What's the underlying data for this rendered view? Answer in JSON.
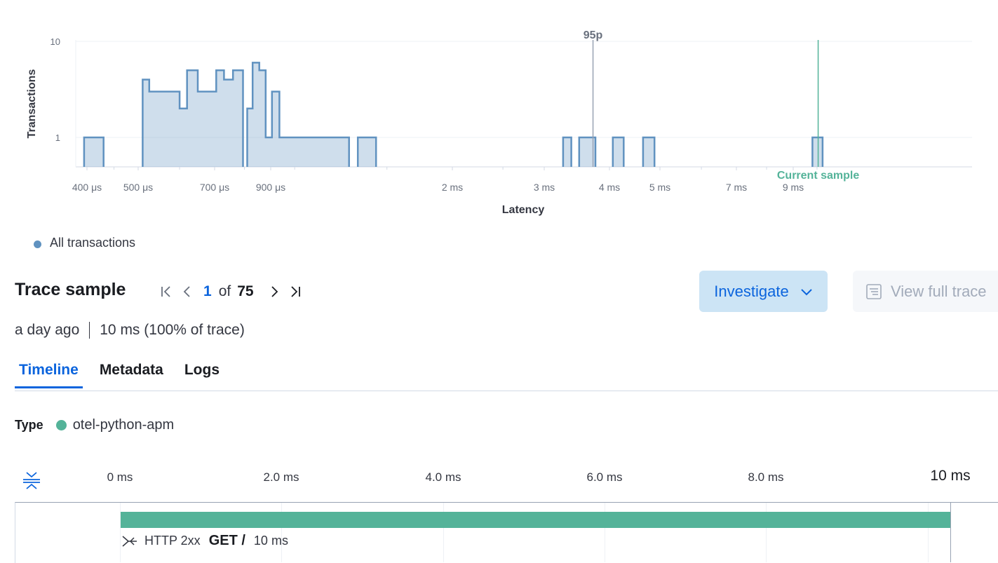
{
  "chart_data": {
    "type": "bar",
    "xlabel": "Latency",
    "ylabel": "Transactions",
    "y_scale": "log",
    "y_ticks": [
      "1",
      "10"
    ],
    "x_scale": "log",
    "x_ticks": [
      "400 μs",
      "500 μs",
      "700 μs",
      "900 μs",
      "2 ms",
      "3 ms",
      "4 ms",
      "5 ms",
      "7 ms",
      "9 ms"
    ],
    "x_tick_values_us": [
      400,
      500,
      700,
      900,
      2000,
      3000,
      4000,
      5000,
      7000,
      9000
    ],
    "bins_us": [
      {
        "x0": 395,
        "x1": 430,
        "y": 1
      },
      {
        "x0": 510,
        "x1": 525,
        "y": 4
      },
      {
        "x0": 525,
        "x1": 600,
        "y": 3
      },
      {
        "x0": 600,
        "x1": 620,
        "y": 2
      },
      {
        "x0": 620,
        "x1": 650,
        "y": 5
      },
      {
        "x0": 650,
        "x1": 705,
        "y": 3
      },
      {
        "x0": 705,
        "x1": 730,
        "y": 5
      },
      {
        "x0": 730,
        "x1": 760,
        "y": 4
      },
      {
        "x0": 760,
        "x1": 795,
        "y": 5
      },
      {
        "x0": 810,
        "x1": 830,
        "y": 2
      },
      {
        "x0": 830,
        "x1": 855,
        "y": 6
      },
      {
        "x0": 855,
        "x1": 880,
        "y": 5
      },
      {
        "x0": 880,
        "x1": 905,
        "y": 1
      },
      {
        "x0": 905,
        "x1": 935,
        "y": 3
      },
      {
        "x0": 935,
        "x1": 1270,
        "y": 1
      },
      {
        "x0": 1320,
        "x1": 1430,
        "y": 1
      },
      {
        "x0": 3260,
        "x1": 3380,
        "y": 1
      },
      {
        "x0": 3500,
        "x1": 3760,
        "y": 1
      },
      {
        "x0": 4060,
        "x1": 4260,
        "y": 1
      },
      {
        "x0": 4640,
        "x1": 4880,
        "y": 1
      },
      {
        "x0": 9800,
        "x1": 10250,
        "y": 1
      }
    ],
    "markers": [
      {
        "label": "95p",
        "x_us": 3720,
        "color": "#98a2b3"
      },
      {
        "label": "Current sample",
        "x_us": 10050,
        "color": "#54b399"
      }
    ],
    "series": [
      {
        "name": "All transactions",
        "color": "#6092c0"
      }
    ],
    "grid": true
  },
  "legend": {
    "label": "All transactions"
  },
  "trace": {
    "title": "Trace sample",
    "pager": {
      "current": "1",
      "of": "of",
      "total": "75"
    },
    "investigate_label": "Investigate",
    "view_full_trace_label": "View full trace",
    "age": "a day ago",
    "duration": "10 ms",
    "percent": " (100% of trace)"
  },
  "tabs": [
    {
      "label": "Timeline",
      "active": true
    },
    {
      "label": "Metadata",
      "active": false
    },
    {
      "label": "Logs",
      "active": false
    }
  ],
  "type_row": {
    "label": "Type",
    "value": "otel-python-apm",
    "color": "#54b399"
  },
  "timeline": {
    "ticks": [
      "0 ms",
      "2.0 ms",
      "4.0 ms",
      "6.0 ms",
      "8.0 ms"
    ],
    "end_label": "10 ms",
    "span": {
      "status": "HTTP 2xx",
      "name": "GET /",
      "duration": "10 ms",
      "color": "#54b399"
    }
  }
}
